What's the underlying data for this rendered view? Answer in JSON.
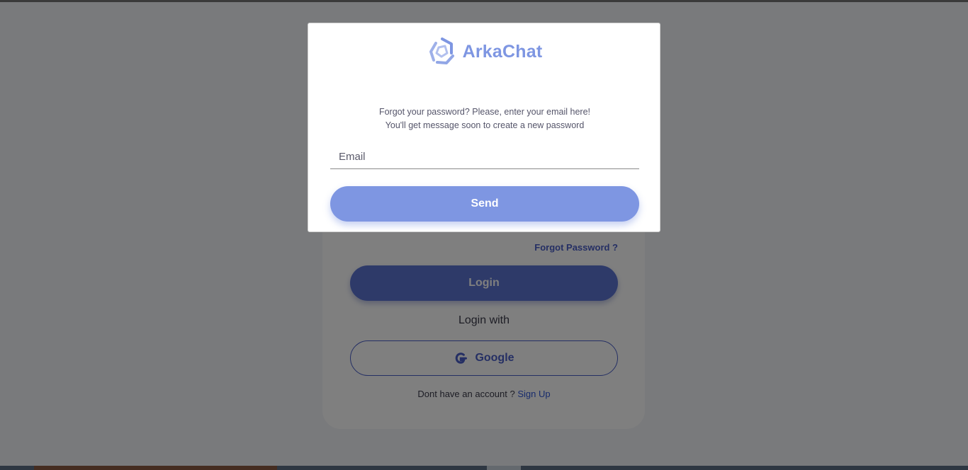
{
  "colors": {
    "accent": "#7e96e2",
    "login_button": "#5d74d3",
    "link": "#4a5fc9",
    "signup_link": "#2f56d8",
    "overlay": "rgba(0,0,0,0.5)"
  },
  "background_form": {
    "forgot_password_link": "Forgot Password ?",
    "login_button": "Login",
    "login_with_label": "Login with",
    "google_button": {
      "icon": "google-g-icon",
      "label": "Google"
    },
    "signup_prompt": "Dont have an account ?",
    "signup_link": "Sign Up"
  },
  "modal": {
    "logo": {
      "icon": "arkachat-logo-icon",
      "name": "ArkaChat"
    },
    "message_line1": "Forgot your password? Please, enter your email here!",
    "message_line2": "You'll get message soon to create a new password",
    "email_input": {
      "placeholder": "Email",
      "value": ""
    },
    "send_button": "Send"
  }
}
